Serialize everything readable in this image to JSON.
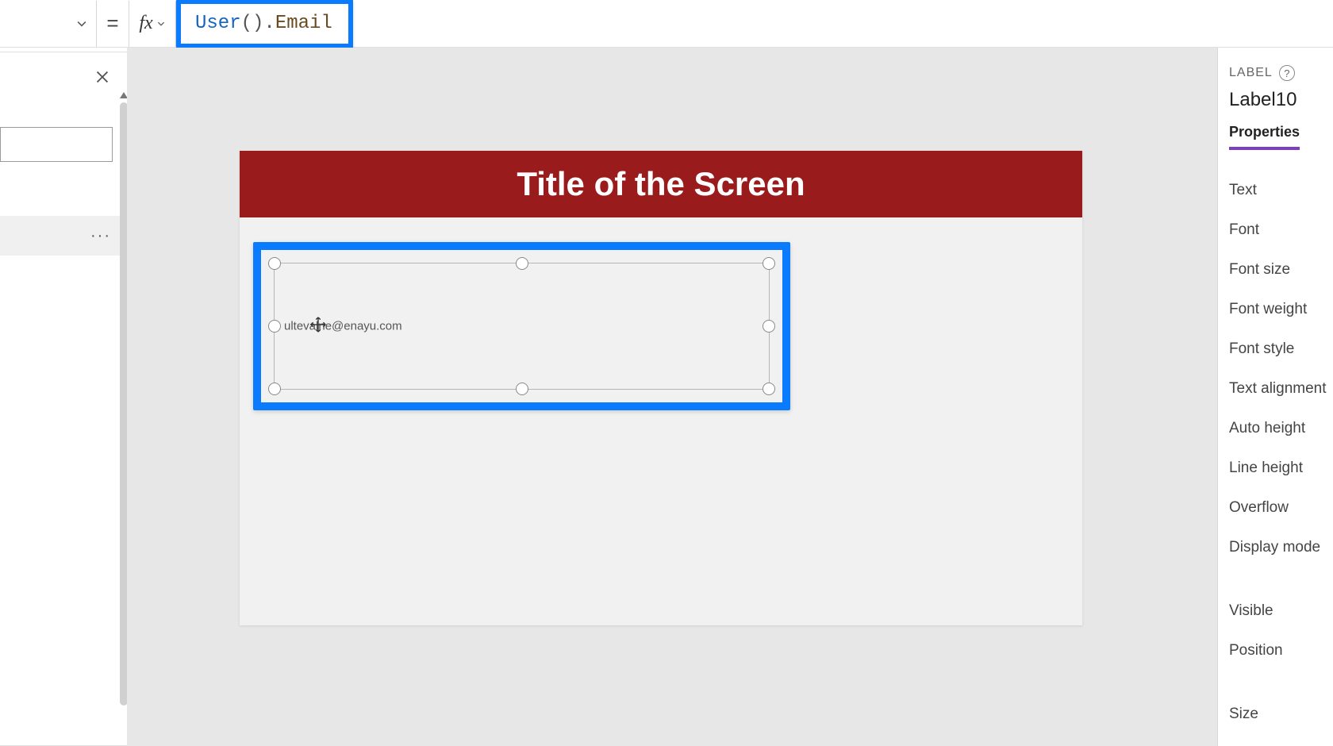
{
  "formula_bar": {
    "fx_label": "fx",
    "tokens": {
      "fn": "User",
      "open": "(",
      "close": ")",
      "dot": ".",
      "prop": "Email"
    }
  },
  "left_panel": {
    "item_actions": "···"
  },
  "canvas": {
    "screen_title": "Title of the Screen",
    "selected_label_value": "ultevalne@enayu.com"
  },
  "right_panel": {
    "caption": "LABEL",
    "help": "?",
    "control_name": "Label10",
    "active_tab": "Properties",
    "groups": [
      [
        "Text",
        "Font",
        "Font size",
        "Font weight",
        "Font style",
        "Text alignment",
        "Auto height",
        "Line height",
        "Overflow",
        "Display mode"
      ],
      [
        "Visible",
        "Position"
      ],
      [
        "Size"
      ]
    ]
  }
}
